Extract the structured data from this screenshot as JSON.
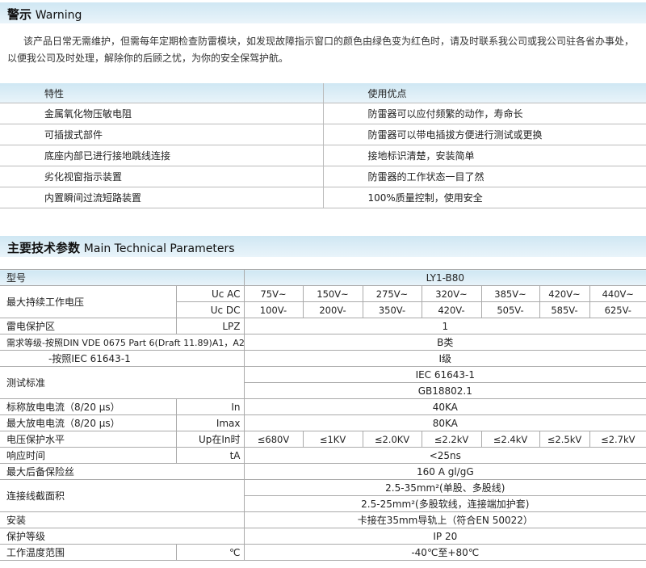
{
  "warning": {
    "title_cn": "警示",
    "title_en": "Warning",
    "text": "该产品日常无需维护，但需每年定期检查防雷模块，如发现故障指示窗口的颜色由绿色变为红色时，请及时联系我公司或我公司驻各省办事处，以便我公司及时处理，解除你的后顾之忧，为你的安全保驾护航。"
  },
  "features": {
    "header": [
      "特性",
      "使用优点"
    ],
    "rows": [
      [
        "金属氧化物压敏电阻",
        "防雷器可以应付频繁的动作，寿命长"
      ],
      [
        "可插拔式部件",
        "防雷器可以带电插拔方便进行测试或更换"
      ],
      [
        "底座内部已进行接地跳线连接",
        "接地标识清楚，安装简单"
      ],
      [
        "劣化视窗指示装置",
        "防雷器的工作状态一目了然"
      ],
      [
        "内置瞬间过流短路装置",
        "100%质量控制，使用安全"
      ]
    ]
  },
  "params": {
    "title_cn": "主要技术参数",
    "title_en": "Main Technical Parameters",
    "model_label": "型号",
    "model_value": "LY1-B80",
    "voltage": {
      "label": "最大持续工作电压",
      "ac_label": "Uc AC",
      "dc_label": "Uc DC",
      "ac_values": [
        "75V~",
        "150V~",
        "275V~",
        "320V~",
        "385V~",
        "420V~",
        "440V~"
      ],
      "dc_values": [
        "100V-",
        "200V-",
        "350V-",
        "420V-",
        "505V-",
        "585V-",
        "625V-"
      ]
    },
    "lpz": {
      "label": "雷电保护区",
      "unit": "LPZ",
      "value": "1"
    },
    "req1": {
      "label": "需求等级-按照DIN VDE 0675 Part 6(Draft 11.89)A1，A2",
      "value": "B类"
    },
    "req2": {
      "label": "-按照IEC 61643-1",
      "value": "I级"
    },
    "standard": {
      "label": "测试标准",
      "values": [
        "IEC 61643-1",
        "GB18802.1"
      ]
    },
    "in": {
      "label": "标称放电电流（8/20 μs）",
      "unit": "In",
      "value": "40KA"
    },
    "imax": {
      "label": "最大放电电流（8/20 μs）",
      "unit": "Imax",
      "value": "80KA"
    },
    "up": {
      "label": "电压保护水平",
      "unit": "Up在In时",
      "values": [
        "≤680V",
        "≤1KV",
        "≤2.0KV",
        "≤2.2kV",
        "≤2.4kV",
        "≤2.5kV",
        "≤2.7kV"
      ]
    },
    "ta": {
      "label": "响应时间",
      "unit": "tA",
      "value": "<25ns"
    },
    "fuse": {
      "label": "最大后备保险丝",
      "value": "160 A gl/gG"
    },
    "wire": {
      "label": "连接线截面积",
      "values": [
        "2.5-35mm²(单股、多股线)",
        "2.5-25mm²(多股软线，连接端加护套)"
      ]
    },
    "install": {
      "label": "安装",
      "value": "卡接在35mm导轨上（符合EN 50022）"
    },
    "ip": {
      "label": "保护等级",
      "value": "IP 20"
    },
    "temp": {
      "label": "工作温度范围",
      "unit": "℃",
      "value": "-40℃至+80℃"
    }
  }
}
